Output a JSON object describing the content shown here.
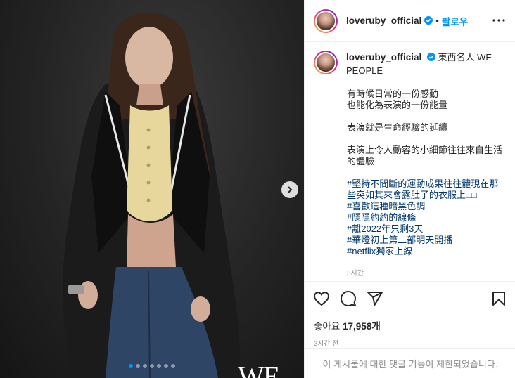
{
  "post": {
    "username": "loveruby_official",
    "follow_label": "팔로우",
    "separator": "•",
    "location": "東西名人 WE PEOPLE",
    "caption_lines": [
      "有時候日常的一份感動",
      "也能化為表演的一份能量",
      "",
      "表演就是生命經驗的延續",
      "",
      "表演上令人動容的小細節往往來自生活的體驗",
      "",
      "#堅持不間斷的運動成果往往體現在那些突如其來會露肚子的衣服上□□",
      "#喜歡這種暗黑色調",
      "#隱隱約約的線條",
      "#離2022年只剩3天",
      "#華燈初上第二部明天開播",
      "#netflix獨家上線"
    ],
    "caption_time": "3시간",
    "likes_label": "좋아요",
    "likes_count": "17,958개",
    "timestamp": "3시간 전",
    "comments_disabled": "이 게시물에 대한 댓글 기능이 제한되었습니다.",
    "carousel": {
      "count": 7,
      "active_index": 0
    },
    "watermark": "WE"
  },
  "icons": {
    "verified": "verified-badge-icon",
    "more": "more-options-icon",
    "like": "heart-icon",
    "comment": "comment-icon",
    "share": "share-icon",
    "save": "bookmark-icon",
    "next": "chevron-right-icon"
  },
  "colors": {
    "accent": "#0095f6",
    "text": "#262626",
    "muted": "#8e8e8e",
    "hashtag": "#00376b"
  }
}
